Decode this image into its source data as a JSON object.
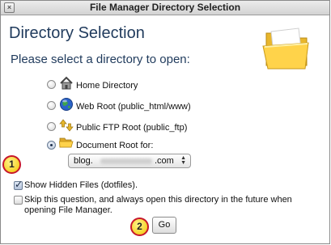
{
  "window": {
    "title": "File Manager Directory Selection",
    "close_glyph": "×"
  },
  "main": {
    "heading": "Directory Selection",
    "subheading": "Please select a directory to open:"
  },
  "options": [
    {
      "label": "Home Directory",
      "icon": "home-icon",
      "selected": false
    },
    {
      "label": "Web Root (public_html/www)",
      "icon": "globe-icon",
      "selected": false
    },
    {
      "label": "Public FTP Root (public_ftp)",
      "icon": "ftp-arrows-icon",
      "selected": false
    },
    {
      "label": "Document Root for:",
      "icon": "open-folder-icon",
      "selected": true
    }
  ],
  "document_root_select": {
    "prefix": "blog.",
    "suffix": ".com",
    "arrows": "▲▼"
  },
  "checkboxes": {
    "hidden_files": {
      "label": "Show Hidden Files (dotfiles).",
      "checked": true
    },
    "skip_question": {
      "label": "Skip this question, and always open this directory in the future when opening File Manager.",
      "checked": false
    }
  },
  "go_button": {
    "label": "Go"
  },
  "badges": [
    "1",
    "2"
  ],
  "colors": {
    "accent": "#1f3a5c",
    "badge_fill": "#f2c400",
    "badge_border": "#c7162b"
  }
}
